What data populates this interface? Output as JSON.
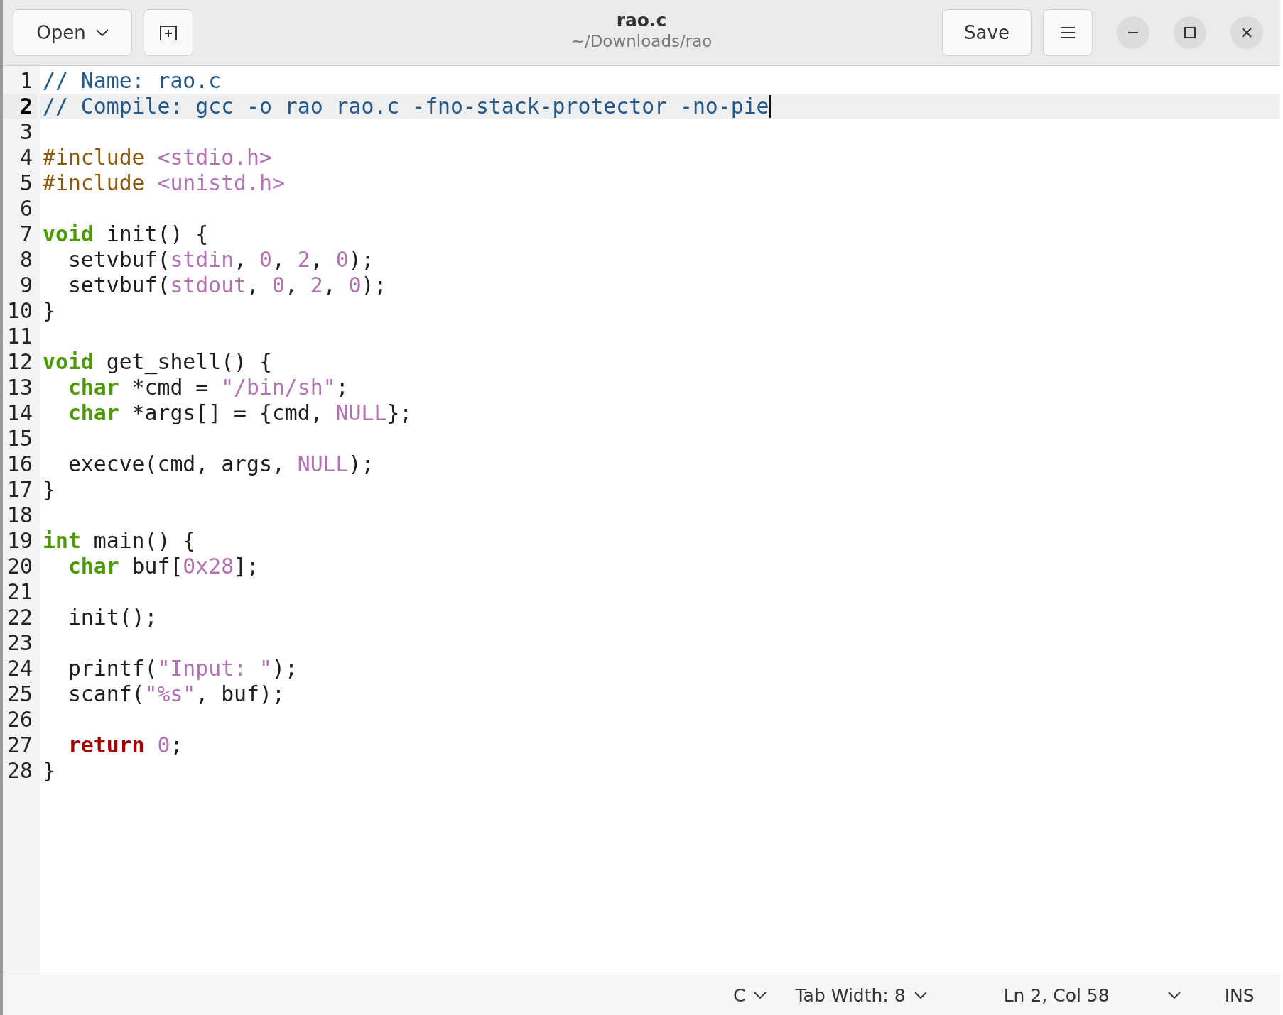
{
  "header": {
    "open_button": "Open",
    "title": "rao.c",
    "subtitle": "~/Downloads/rao",
    "save_button": "Save"
  },
  "editor": {
    "lines": [
      {
        "number": "1",
        "current": false,
        "tokens": [
          {
            "text": "// Name: rao.c",
            "kind": "comment"
          }
        ]
      },
      {
        "number": "2",
        "current": true,
        "tokens": [
          {
            "text": "// Compile: gcc -o rao rao.c -fno-stack-protector -no-pie",
            "kind": "comment"
          }
        ]
      },
      {
        "number": "3",
        "current": false
      },
      {
        "number": "4",
        "current": false,
        "tokens": [
          {
            "text": "#include ",
            "kind": "preproc"
          },
          {
            "text": "<stdio.h>",
            "kind": "string"
          }
        ]
      },
      {
        "number": "5",
        "current": false,
        "tokens": [
          {
            "text": "#include ",
            "kind": "preproc"
          },
          {
            "text": "<unistd.h>",
            "kind": "string"
          }
        ]
      },
      {
        "number": "6",
        "current": false
      },
      {
        "number": "7",
        "current": false,
        "tokens": [
          {
            "text": "void",
            "kind": "type"
          },
          {
            "text": " init() {",
            "kind": "plain"
          }
        ]
      },
      {
        "number": "8",
        "current": false,
        "tokens": [
          {
            "text": "  setvbuf(",
            "kind": "plain"
          },
          {
            "text": "stdin",
            "kind": "constant"
          },
          {
            "text": ", ",
            "kind": "plain"
          },
          {
            "text": "0",
            "kind": "number"
          },
          {
            "text": ", ",
            "kind": "plain"
          },
          {
            "text": "2",
            "kind": "number"
          },
          {
            "text": ", ",
            "kind": "plain"
          },
          {
            "text": "0",
            "kind": "number"
          },
          {
            "text": ");",
            "kind": "plain"
          }
        ]
      },
      {
        "number": "9",
        "current": false,
        "tokens": [
          {
            "text": "  setvbuf(",
            "kind": "plain"
          },
          {
            "text": "stdout",
            "kind": "constant"
          },
          {
            "text": ", ",
            "kind": "plain"
          },
          {
            "text": "0",
            "kind": "number"
          },
          {
            "text": ", ",
            "kind": "plain"
          },
          {
            "text": "2",
            "kind": "number"
          },
          {
            "text": ", ",
            "kind": "plain"
          },
          {
            "text": "0",
            "kind": "number"
          },
          {
            "text": ");",
            "kind": "plain"
          }
        ]
      },
      {
        "number": "10",
        "current": false,
        "tokens": [
          {
            "text": "}",
            "kind": "plain"
          }
        ]
      },
      {
        "number": "11",
        "current": false
      },
      {
        "number": "12",
        "current": false,
        "tokens": [
          {
            "text": "void",
            "kind": "type"
          },
          {
            "text": " get_shell() {",
            "kind": "plain"
          }
        ]
      },
      {
        "number": "13",
        "current": false,
        "tokens": [
          {
            "text": "  char",
            "kind": "type"
          },
          {
            "text": " *cmd = ",
            "kind": "plain"
          },
          {
            "text": "\"/bin/sh\"",
            "kind": "string"
          },
          {
            "text": ";",
            "kind": "plain"
          }
        ]
      },
      {
        "number": "14",
        "current": false,
        "tokens": [
          {
            "text": "  char",
            "kind": "type"
          },
          {
            "text": " *args[] = {cmd, ",
            "kind": "plain"
          },
          {
            "text": "NULL",
            "kind": "constant"
          },
          {
            "text": "};",
            "kind": "plain"
          }
        ]
      },
      {
        "number": "15",
        "current": false
      },
      {
        "number": "16",
        "current": false,
        "tokens": [
          {
            "text": "  execve(cmd, args, ",
            "kind": "plain"
          },
          {
            "text": "NULL",
            "kind": "constant"
          },
          {
            "text": ");",
            "kind": "plain"
          }
        ]
      },
      {
        "number": "17",
        "current": false,
        "tokens": [
          {
            "text": "}",
            "kind": "plain"
          }
        ]
      },
      {
        "number": "18",
        "current": false
      },
      {
        "number": "19",
        "current": false,
        "tokens": [
          {
            "text": "int",
            "kind": "type"
          },
          {
            "text": " main() {",
            "kind": "plain"
          }
        ]
      },
      {
        "number": "20",
        "current": false,
        "tokens": [
          {
            "text": "  char",
            "kind": "type"
          },
          {
            "text": " buf[",
            "kind": "plain"
          },
          {
            "text": "0x28",
            "kind": "number"
          },
          {
            "text": "];",
            "kind": "plain"
          }
        ]
      },
      {
        "number": "21",
        "current": false
      },
      {
        "number": "22",
        "current": false,
        "tokens": [
          {
            "text": "  init();",
            "kind": "plain"
          }
        ]
      },
      {
        "number": "23",
        "current": false
      },
      {
        "number": "24",
        "current": false,
        "tokens": [
          {
            "text": "  printf(",
            "kind": "plain"
          },
          {
            "text": "\"Input: \"",
            "kind": "string"
          },
          {
            "text": ");",
            "kind": "plain"
          }
        ]
      },
      {
        "number": "25",
        "current": false,
        "tokens": [
          {
            "text": "  scanf(",
            "kind": "plain"
          },
          {
            "text": "\"%s\"",
            "kind": "string"
          },
          {
            "text": ", buf);",
            "kind": "plain"
          }
        ]
      },
      {
        "number": "26",
        "current": false
      },
      {
        "number": "27",
        "current": false,
        "tokens": [
          {
            "text": "  return",
            "kind": "keyword"
          },
          {
            "text": " 0",
            "kind": "number"
          },
          {
            "text": ";",
            "kind": "plain"
          }
        ]
      },
      {
        "number": "28",
        "current": false,
        "tokens": [
          {
            "text": "}",
            "kind": "plain"
          }
        ]
      }
    ]
  },
  "status_bar": {
    "language": "C",
    "tab_width": "Tab Width: 8",
    "position": "Ln 2, Col 58",
    "mode": "INS"
  }
}
